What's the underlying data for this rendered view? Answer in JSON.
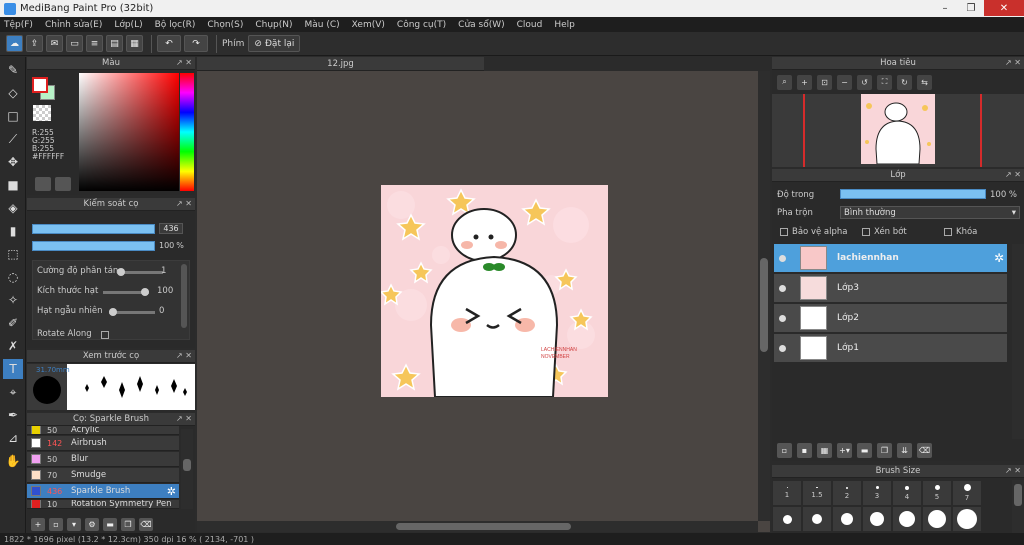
{
  "window": {
    "title": "MediBang Paint Pro (32bit)"
  },
  "menu": [
    "Tệp(F)",
    "Chỉnh sửa(E)",
    "Lớp(L)",
    "Bộ lọc(R)",
    "Chọn(S)",
    "Chụp(N)",
    "Màu (C)",
    "Xem(V)",
    "Công cụ(T)",
    "Cửa sổ(W)",
    "Cloud",
    "Help"
  ],
  "toolbar": {
    "brush_label": "Phím",
    "reset_label": "Đặt lại"
  },
  "color_panel": {
    "title": "Màu",
    "r": "R:255",
    "g": "G:255",
    "b": "B:255",
    "hex": "#FFFFFF",
    "fg_color": "#ffffff",
    "bg_color": "#b8f2c8"
  },
  "brush_control": {
    "title": "Kiểm soát cọ",
    "size_value": "436",
    "opacity_value": "100",
    "opacity_unit": "%",
    "params": [
      {
        "label": "Cường độ phân tán",
        "value": "1"
      },
      {
        "label": "Kích thước hạt",
        "value": "100"
      },
      {
        "label": "Hạt ngẫu nhiên",
        "value": "0"
      },
      {
        "label": "Rotate Along",
        "value": ""
      }
    ]
  },
  "brush_preview": {
    "title": "Xem trước cọ",
    "size_mm": "31.70mm"
  },
  "brush_list": {
    "title": "Cọ: Sparkle Brush",
    "items": [
      {
        "size": "50",
        "name": "Acrylic",
        "color": "#e8d000"
      },
      {
        "size": "142",
        "name": "Airbrush",
        "color": "#ffffff"
      },
      {
        "size": "50",
        "name": "Blur",
        "color": "#f0a0f0"
      },
      {
        "size": "70",
        "name": "Smudge",
        "color": "#fde0c8"
      },
      {
        "size": "436",
        "name": "Sparkle Brush",
        "color": "#3050d0"
      },
      {
        "size": "10",
        "name": "Rotation Symmetry Pen",
        "color": "#e02020"
      }
    ]
  },
  "canvas": {
    "tab_title": "12.jpg"
  },
  "navigator": {
    "title": "Hoa tiêu"
  },
  "layers": {
    "title": "Lớp",
    "opacity_label": "Độ trong",
    "opacity_value": "100 %",
    "blend_label": "Pha trộn",
    "blend_value": "Bình thường",
    "checks": [
      "Bảo vệ alpha",
      "Xén bớt",
      "Khóa"
    ],
    "items": [
      {
        "name": "lachiennhan",
        "selected": true
      },
      {
        "name": "Lớp3",
        "selected": false
      },
      {
        "name": "Lớp2",
        "selected": false
      },
      {
        "name": "Lớp1",
        "selected": false
      }
    ]
  },
  "brush_size": {
    "title": "Brush Size",
    "sizes": [
      "1",
      "1.5",
      "2",
      "3",
      "4",
      "5",
      "7"
    ]
  },
  "status": {
    "text": "1822 * 1696 pixel   (13.2 * 12.3cm)   350 dpi   16 %   ( 2134, -701 )"
  }
}
